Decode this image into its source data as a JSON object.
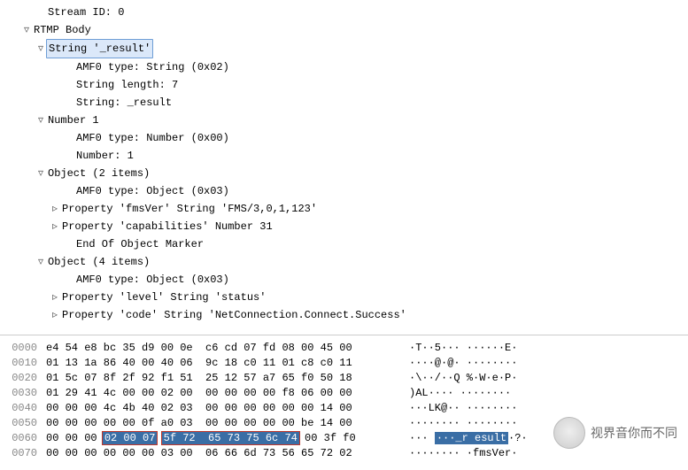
{
  "tree": {
    "stream_id": "Stream ID: 0",
    "rtmp_body": "RTMP Body",
    "string_result": {
      "header": "String '_result'",
      "amf0": "AMF0 type: String (0x02)",
      "len": "String length: 7",
      "val": "String: _result"
    },
    "number_1": {
      "header": "Number 1",
      "amf0": "AMF0 type: Number (0x00)",
      "val": "Number: 1"
    },
    "object2": {
      "header": "Object (2 items)",
      "amf0": "AMF0 type: Object (0x03)",
      "p1": "Property 'fmsVer' String 'FMS/3,0,1,123'",
      "p2": "Property 'capabilities' Number 31",
      "end": "End Of Object Marker"
    },
    "object4": {
      "header": "Object (4 items)",
      "amf0": "AMF0 type: Object (0x03)",
      "p1": "Property 'level' String 'status'",
      "p2": "Property 'code' String 'NetConnection.Connect.Success'"
    }
  },
  "hex": {
    "rows": [
      {
        "off": "0000",
        "b": "e4 54 e8 bc 35 d9 00 0e  c6 cd 07 fd 08 00 45 00",
        "a": "·T··5··· ······E·"
      },
      {
        "off": "0010",
        "b": "01 13 1a 86 40 00 40 06  9c 18 c0 11 01 c8 c0 11",
        "a": "····@·@· ········"
      },
      {
        "off": "0020",
        "b": "01 5c 07 8f 2f 92 f1 51  25 12 57 a7 65 f0 50 18",
        "a": "·\\··/··Q %·W·e·P·"
      },
      {
        "off": "0030",
        "b": "01 29 41 4c 00 00 02 00  00 00 00 00 f8 06 00 00",
        "a": ")AL···· ········"
      },
      {
        "off": "0040",
        "b": "00 00 00 4c 4b 40 02 03  00 00 00 00 00 00 14 00",
        "a": "···LK@·· ········"
      },
      {
        "off": "0050",
        "b": "00 00 00 00 00 0f a0 03  00 00 00 00 00 be 14 00",
        "a": "········ ········"
      },
      {
        "off": "0070",
        "b": "00 00 00 00 00 00 03 00  06 66 6d 73 56 65 72 02",
        "a": "········ ·fmsVer·"
      }
    ],
    "row60": {
      "off": "0060",
      "pre": "00 00 00 ",
      "sel1": "02 00 07",
      "gap": " ",
      "sel2": "5f 72  65 73 75 6c 74",
      "post": " 00 3f f0",
      "apre": "··· ",
      "asel": "···_r esult",
      "apost": "·?·"
    }
  },
  "watermark": "视界音你而不同"
}
